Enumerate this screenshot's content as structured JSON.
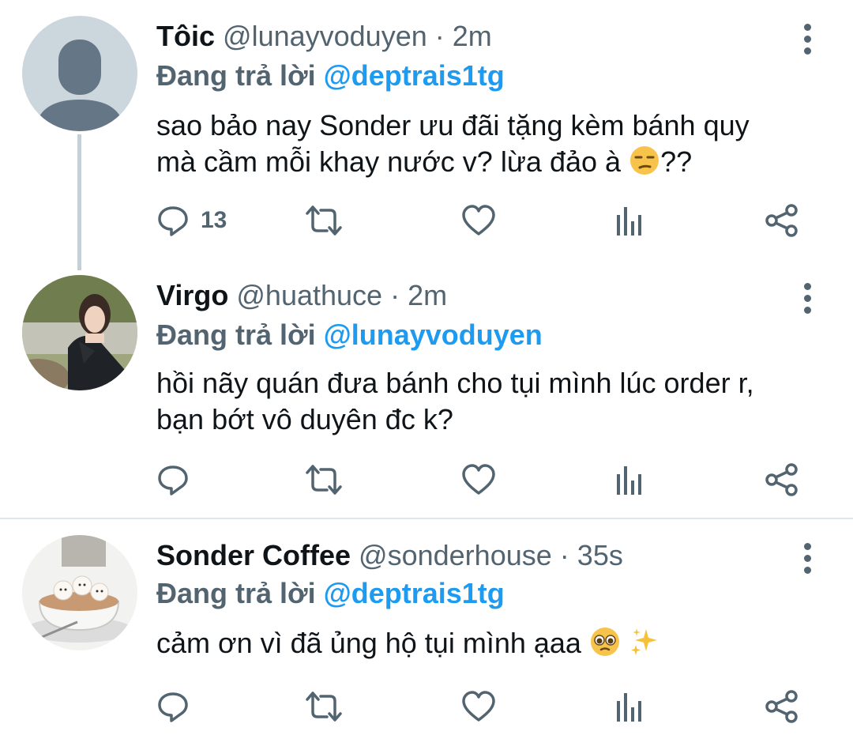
{
  "tweets": [
    {
      "name": "Tôic",
      "handle": "@lunayvoduyen",
      "dot": "·",
      "time": "2m",
      "replying_prefix": "Đang trả lời",
      "replying_to": "@deptrais1tg",
      "line1": "sao bảo nay Sonder ưu đãi tặng kèm bánh quy",
      "line2": "mà cầm mỗi khay nước v? lừa đảo à",
      "line2_emoji": "unamused-face-emoji",
      "line2_suffix": "??",
      "reply_count": "13"
    },
    {
      "name": "Virgo",
      "handle": "@huathuce",
      "dot": "·",
      "time": "2m",
      "replying_prefix": "Đang trả lời",
      "replying_to": "@lunayvoduyen",
      "line1": "hồi nãy quán đưa bánh cho tụi mình lúc order r,",
      "line2": "bạn bớt vô duyên đc k?",
      "reply_count": ""
    },
    {
      "name": "Sonder Coffee",
      "handle": "@sonderhouse",
      "dot": "·",
      "time": "35s",
      "replying_prefix": "Đang trả lời",
      "replying_to": "@deptrais1tg",
      "line1": "cảm ơn vì đã ủng hộ tụi mình ạaa",
      "line1_emojis": [
        "pleading-face-emoji",
        "sparkles-emoji"
      ],
      "reply_count": ""
    }
  ],
  "icons": {
    "reply": "reply-icon",
    "retweet": "retweet-icon",
    "like": "like-icon",
    "analytics": "analytics-icon",
    "share": "share-icon",
    "more": "more-options-icon"
  },
  "colors": {
    "accent": "#1d9bf0",
    "secondary": "#536471",
    "thread_line": "#c4cfd6"
  }
}
